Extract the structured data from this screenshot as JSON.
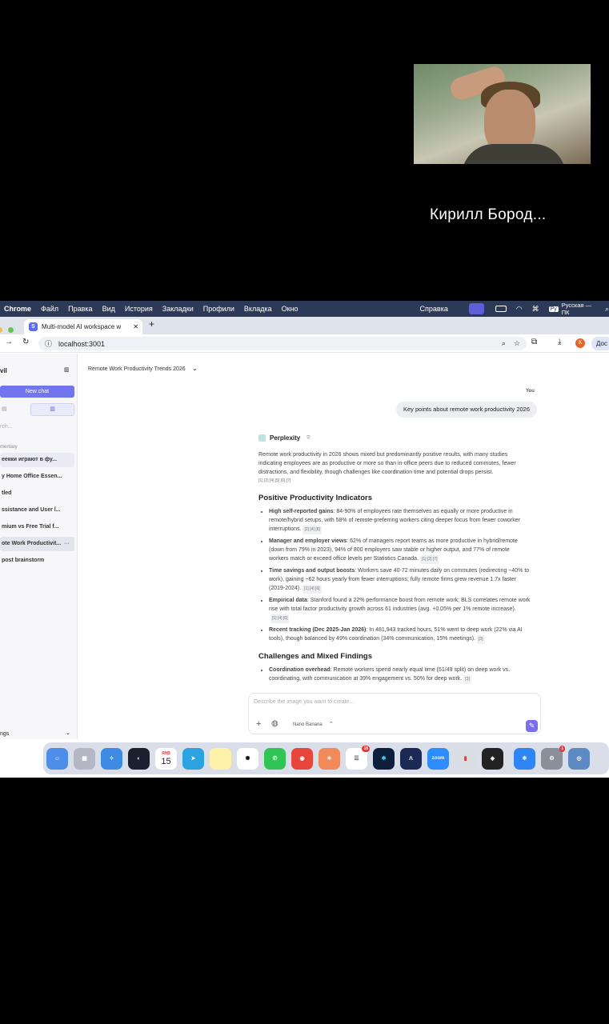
{
  "caller": {
    "name": "Кирилл Бород..."
  },
  "menubar": {
    "app": "Chrome",
    "items": [
      "Файл",
      "Правка",
      "Вид",
      "История",
      "Закладки",
      "Профили",
      "Вкладка",
      "Окно"
    ],
    "help": "Справка",
    "input": "Русская — ПК",
    "lang_badge": "Ру"
  },
  "browser": {
    "tab_title": "Multi-model AI workspace w",
    "url": "localhost:3001",
    "profile": "К",
    "right_tab": "Дос"
  },
  "sidebar": {
    "title": "vil",
    "new_chat": "New chat",
    "search_placeholder": "rch...",
    "section": "mentary",
    "items": [
      "еекки играют в фу...",
      "y Home Office Essen...",
      "tled",
      "ssistance and User l...",
      "mium vs Free Trial f...",
      "ote Work Productivit...",
      "post brainstorm"
    ],
    "footer": "ngs"
  },
  "main": {
    "breadcrumb": "Remote Work Productivity Trends 2026",
    "you_label": "You",
    "user_message": "Key points about remote work productivity 2026",
    "model": "Perplexity",
    "intro": "Remote work productivity in 2026 shows mixed but predominantly positive results, with many studies indicating employees are as productive or more so than in-office peers due to reduced commutes, fewer distractions, and flexibility, though challenges like coordination time and potential drops persist.",
    "intro_cites": "[1] [2] [4] [5] [6] [7]",
    "h1": "Positive Productivity Indicators",
    "b1_title": "High self-reported gains",
    "b1_text": ": 84-90% of employees rate themselves as equally or more productive in remote/hybrid setups, with 58% of remote-preferring workers citing deeper focus from fewer coworker interruptions.",
    "b1_cites": "[2] [4] [8]",
    "b2_title": "Manager and employer views",
    "b2_text": ": 62% of managers report teams as more productive in hybrid/remote (down from 79% in 2023), 94% of 800 employers saw stable or higher output, and 77% of remote workers match or exceed office levels per Statistics Canada.",
    "b2_cites": "[1] [2] [7]",
    "b3_title": "Time savings and output boosts",
    "b3_text": ": Workers save 40-72 minutes daily on commutes (redirecting ~40% to work), gaining ~62 hours yearly from fewer interruptions; fully remote firms grew revenue 1.7x faster (2019-2024).",
    "b3_cites": "[1] [4] [6]",
    "b4_title": "Empirical data",
    "b4_text": ": Stanford found a 22% performance boost from remote work; BLS correlates remote work rise with total factor productivity growth across 61 industries (avg. +0.05% per 1% remote increase).",
    "b4_cites": "[1] [4] [6]",
    "b5_title": "Recent tracking (Dec 2025-Jan 2026)",
    "b5_text": ": In 481,943 tracked hours, 51% went to deep work (22% via AI tools), though balanced by 49% coordination (34% communication, 15% meetings).",
    "b5_cites": "[3]",
    "h2": "Challenges and Mixed Findings",
    "c1_title": "Coordination overhead",
    "c1_text": ": Remote workers spend nearly equal time (51/49 split) on deep work vs. coordinating, with communication at 39% engagement vs. 50% for deep work.",
    "c1_cites": "[3]",
    "composer_placeholder": "Describe the image you want to create...",
    "composer_model": "Nano Banana"
  },
  "dock": {
    "calendar_day": "15",
    "calendar_month": "ЯНВ",
    "zoom": "zoom",
    "badge_reminders": "18",
    "badge_settings": "1"
  }
}
